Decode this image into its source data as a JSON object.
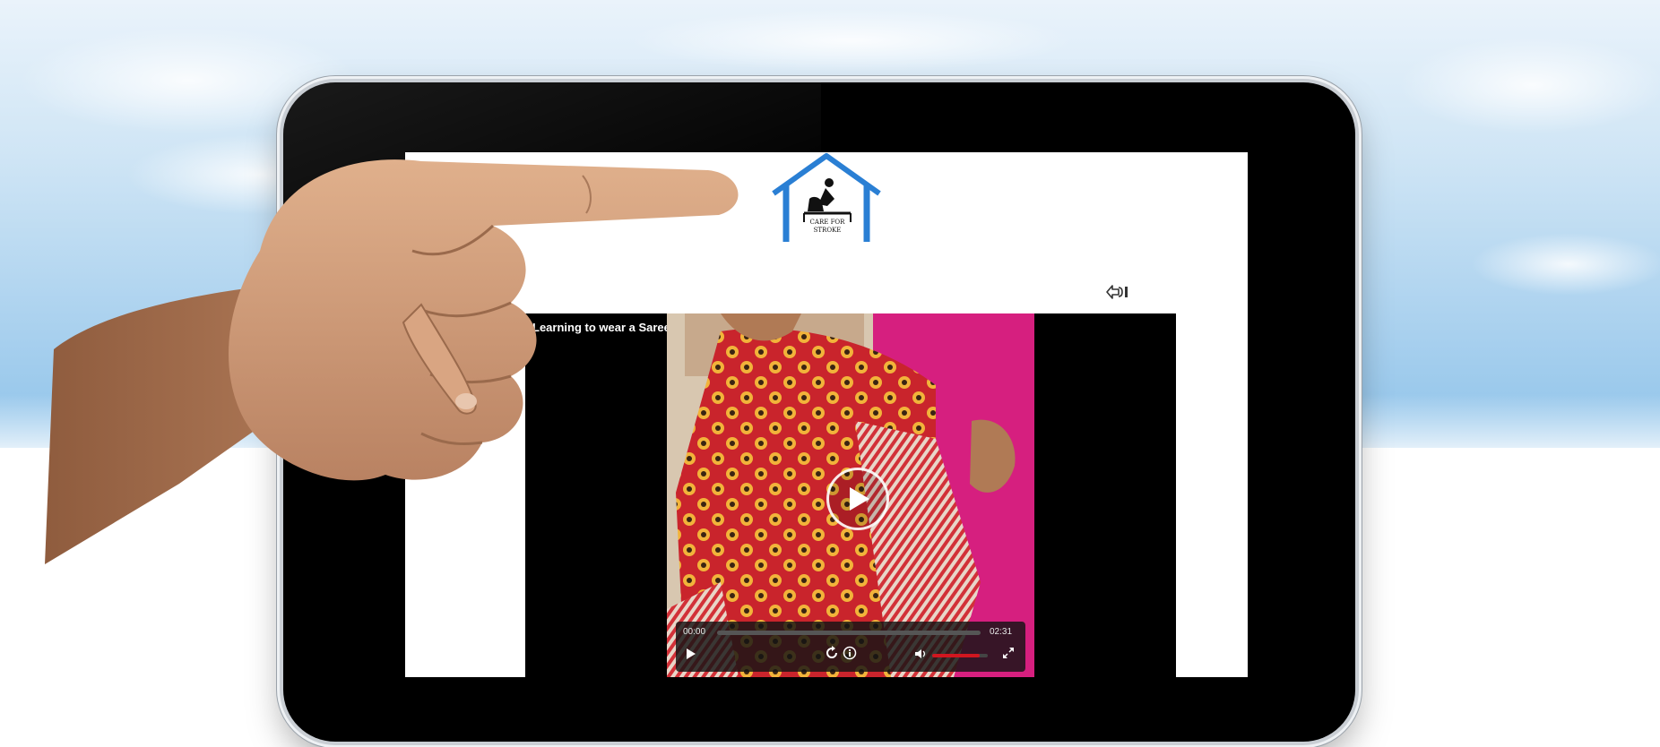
{
  "logo": {
    "text_line1": "CARE FOR",
    "text_line2": "STROKE"
  },
  "video": {
    "title": "Learning to wear a Saree",
    "current_time": "00:00",
    "duration": "02:31",
    "progress_fraction": 0,
    "volume_fraction": 0.85
  },
  "colors": {
    "logo_blue": "#2a7fd4",
    "volume_red": "#d0161f",
    "saree_red": "#c9242c"
  },
  "icons": {
    "exit": "exit-icon",
    "play_big": "play-icon",
    "play_small": "play-icon",
    "replay": "replay-icon",
    "info": "info-icon",
    "volume": "volume-icon",
    "fullscreen": "fullscreen-icon"
  }
}
